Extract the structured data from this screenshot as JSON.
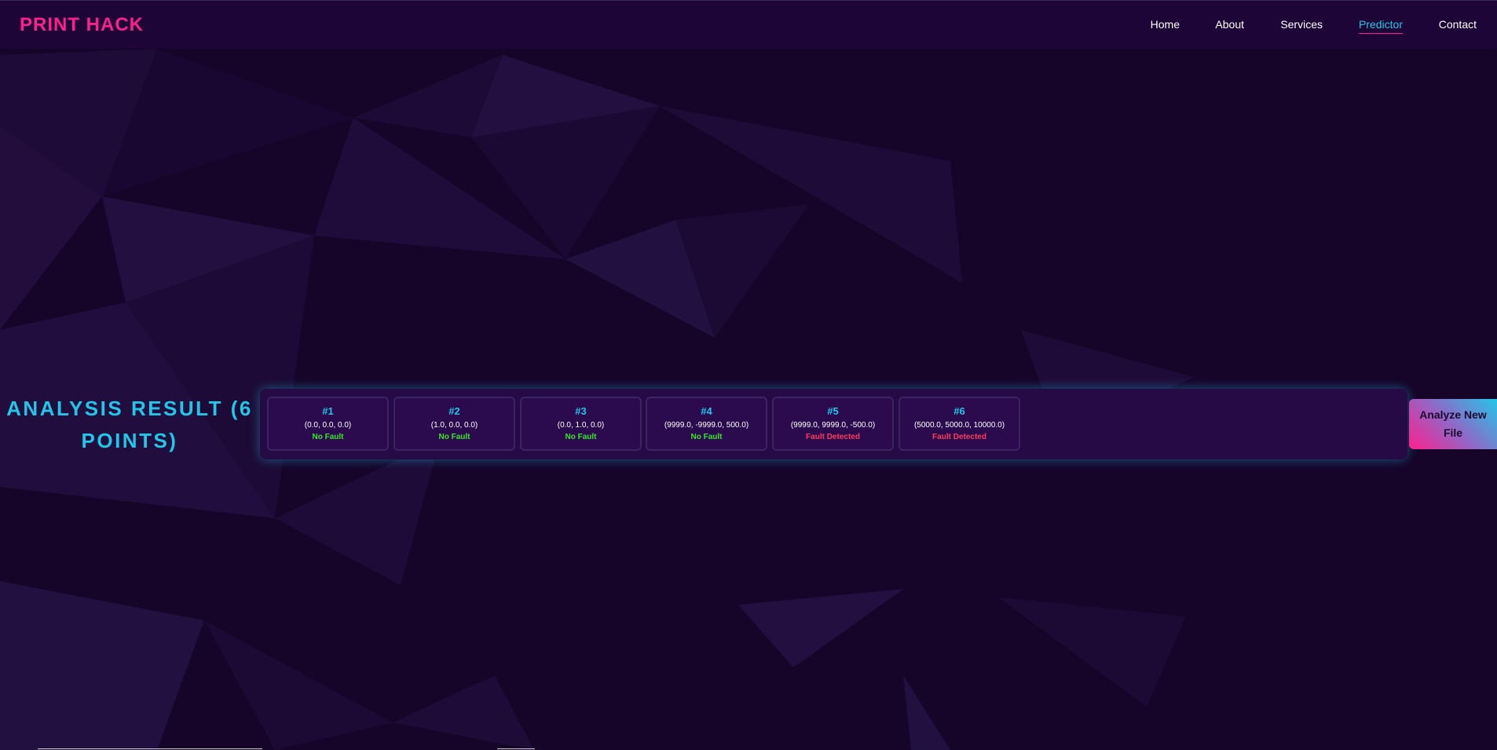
{
  "colors": {
    "accent_pink": "#ff1f8e",
    "accent_cyan": "#22c7e8",
    "status_ok": "#38e62a",
    "status_fault": "#ff3b5c",
    "background": "#160429"
  },
  "navbar": {
    "brand": "PRINT HACK",
    "links": [
      {
        "label": "Home",
        "active": false
      },
      {
        "label": "About",
        "active": false
      },
      {
        "label": "Services",
        "active": false
      },
      {
        "label": "Predictor",
        "active": true
      },
      {
        "label": "Contact",
        "active": false
      }
    ]
  },
  "result": {
    "title": "ANALYSIS RESULT (6 POINTS)",
    "points": [
      {
        "id": "#1",
        "coords": "(0.0, 0.0, 0.0)",
        "status": "No Fault",
        "fault": false
      },
      {
        "id": "#2",
        "coords": "(1.0, 0.0, 0.0)",
        "status": "No Fault",
        "fault": false
      },
      {
        "id": "#3",
        "coords": "(0.0, 1.0, 0.0)",
        "status": "No Fault",
        "fault": false
      },
      {
        "id": "#4",
        "coords": "(9999.0, -9999.0, 500.0)",
        "status": "No Fault",
        "fault": false
      },
      {
        "id": "#5",
        "coords": "(9999.0, 9999.0, -500.0)",
        "status": "Fault Detected",
        "fault": true
      },
      {
        "id": "#6",
        "coords": "(5000.0, 5000.0, 10000.0)",
        "status": "Fault Detected",
        "fault": true
      }
    ],
    "analyze_button": "Analyze New File"
  }
}
